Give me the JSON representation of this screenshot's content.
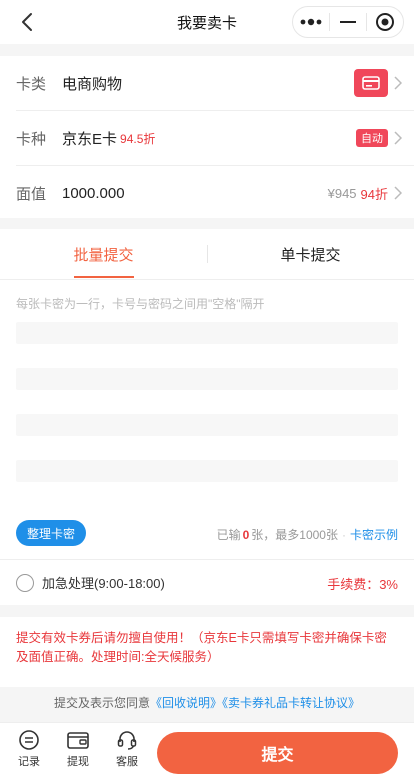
{
  "navbar": {
    "title": "我要卖卡"
  },
  "rows": {
    "category": {
      "label": "卡类",
      "value": "电商购物"
    },
    "kind": {
      "label": "卡种",
      "value": "京东E卡",
      "discount": "94.5折",
      "badge": "自动"
    },
    "face": {
      "label": "面值",
      "value": "1000.000",
      "price": "¥945",
      "discount": "94折"
    }
  },
  "tabs": {
    "batch": "批量提交",
    "single": "单卡提交"
  },
  "entry": {
    "placeholder": "每张卡密为一行，卡号与密码之间用\"空格\"隔开"
  },
  "tools": {
    "tidy_button": "整理卡密",
    "entered_prefix": "已输",
    "entered_count": "0",
    "entered_suffix": "张，最多1000张",
    "sep": "·",
    "example_link": "卡密示例"
  },
  "urgent": {
    "label": "加急处理(9:00-18:00)",
    "fee": "手续费：3%"
  },
  "notice": "提交有效卡券后请勿擅自使用！（京东E卡只需填写卡密并确保卡密及面值正确。处理时间:全天候服务）",
  "agreement": {
    "prefix": "提交及表示您同意",
    "link1": "《回收说明》",
    "link2": "《卖卡券礼品卡转让协议》"
  },
  "bottombar": {
    "records": "记录",
    "withdraw": "提现",
    "service": "客服",
    "submit": "提交"
  },
  "colors": {
    "accent": "#f26341",
    "red": "#e8373b",
    "blue": "#1f8fe8",
    "badge": "#f0475a"
  }
}
